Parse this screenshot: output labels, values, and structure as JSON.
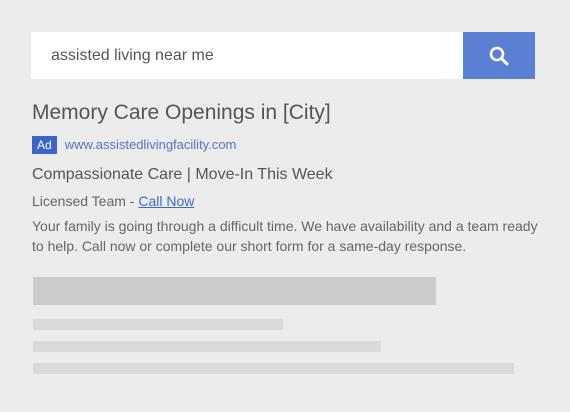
{
  "search": {
    "query": "assisted living near me",
    "button_icon": "search-icon"
  },
  "ad": {
    "title": "Memory Care Openings in [City]",
    "badge": "Ad",
    "url": "www.assistedlivingfacility.com",
    "headline": "Compassionate Care | Move-In This Week",
    "subline_prefix": "Licensed Team - ",
    "call_link": "Call Now",
    "description": "Your family is going through a difficult time. We have availability and a team ready to help. Call now or complete our short form for a same-day response."
  },
  "colors": {
    "accent": "#5a7fd3",
    "link": "#3f6ac4",
    "badge": "#3b66c8",
    "background": "#ececec"
  }
}
